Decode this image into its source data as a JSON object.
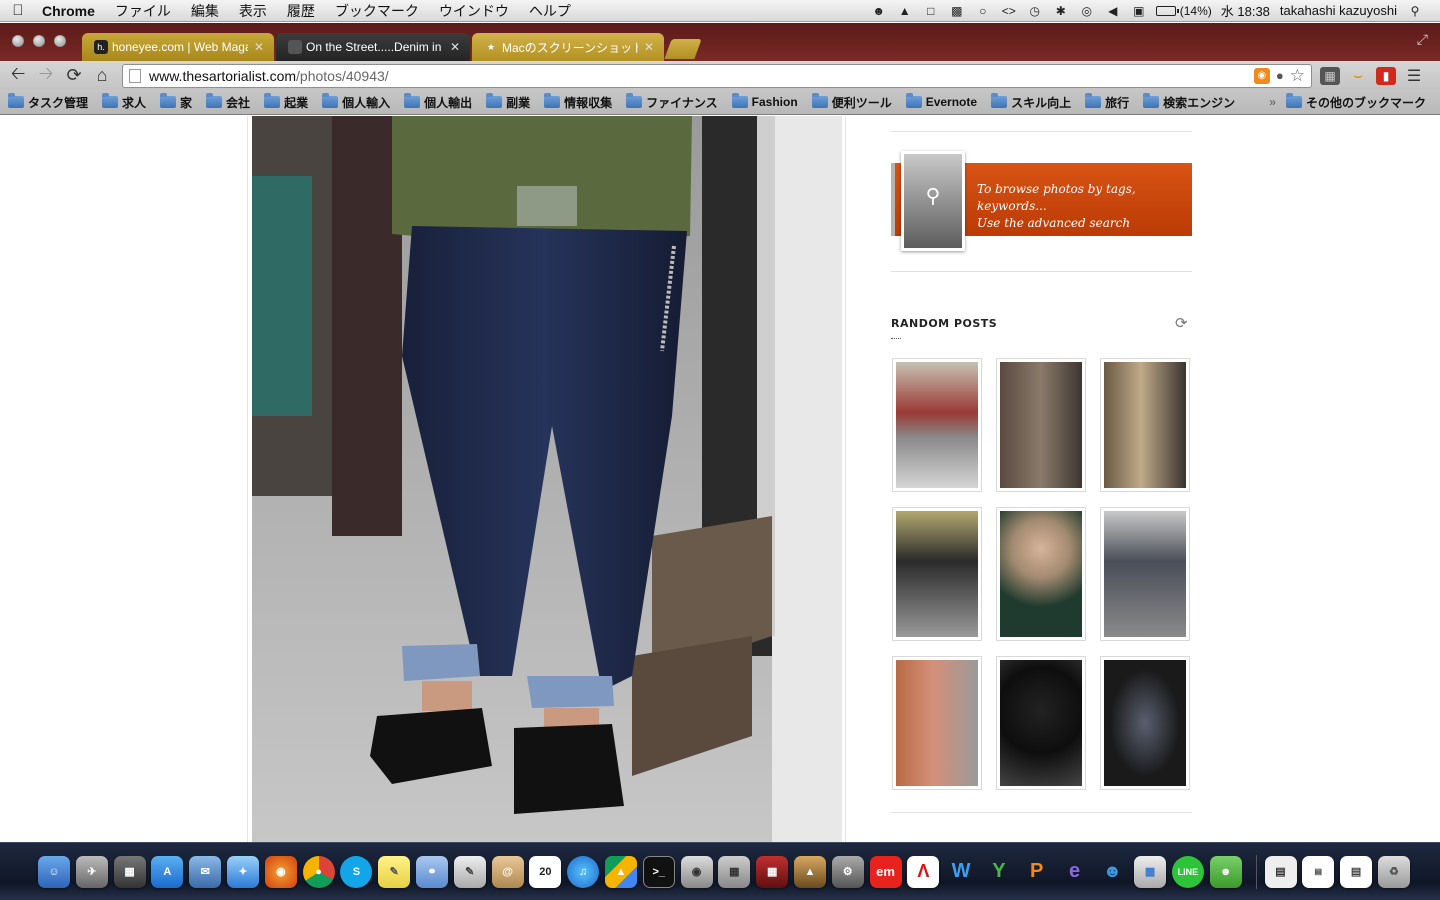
{
  "menubar": {
    "app_name": "Chrome",
    "menus": [
      "ファイル",
      "編集",
      "表示",
      "履歴",
      "ブックマーク",
      "ウインドウ",
      "ヘルプ"
    ],
    "battery": "(14%)",
    "clock": "水 18:38",
    "user": "takahashi kazuyoshi"
  },
  "tabs": [
    {
      "title": "honeyee.com | Web Magaz",
      "favicon": "h."
    },
    {
      "title": "On the Street.....Denim in",
      "favicon": ""
    },
    {
      "title": "Macのスクリーンショット撮",
      "favicon": "★"
    }
  ],
  "address": {
    "host": "www.thesartorialist.com",
    "path": "/photos/40943/"
  },
  "bookmarks": [
    "タスク管理",
    "求人",
    "家",
    "会社",
    "起業",
    "個人輸入",
    "個人輸出",
    "副業",
    "情報収集",
    "ファイナンス",
    "Fashion",
    "便利ツール",
    "Evernote",
    "スキル向上",
    "旅行",
    "検索エンジン"
  ],
  "bookmarks_overflow": "»",
  "bookmarks_other": "その他のブックマーク",
  "sidebar": {
    "search_banner_line1": "To browse photos by tags, keywords...",
    "search_banner_line2": "Use the advanced search",
    "random_posts_title": "RANDOM POSTS"
  },
  "dock": {
    "calendar_day": "20",
    "line_label": "LINE",
    "em_label": "em"
  },
  "colors": {
    "tab_strip": "#6d2320",
    "search_banner": "#d04e10",
    "denim": "#1f2a45",
    "jacket": "#5b6a3e"
  }
}
